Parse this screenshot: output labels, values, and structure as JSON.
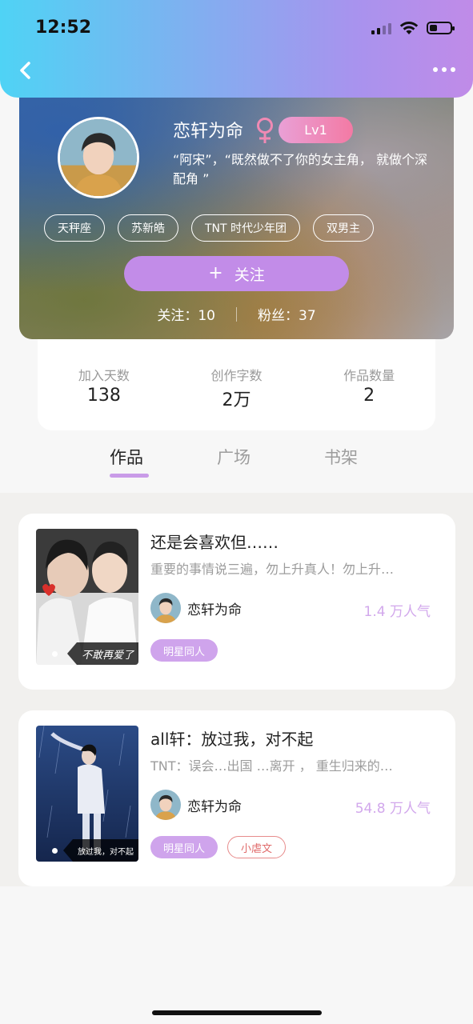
{
  "status_bar": {
    "time": "12:52"
  },
  "profile": {
    "nickname": "恋轩为命",
    "gender_symbol": "♀",
    "level": "Lv1",
    "bio": "“阿宋”，“既然做不了你的女主角， 就做个深",
    "bio_line2": "配角 ”",
    "tags": [
      "天秤座",
      "苏新皓",
      "TNT 时代少年团",
      "双男主"
    ],
    "follow_button": {
      "plus": "+",
      "label": "关注"
    },
    "following": {
      "label": "关注：",
      "value": "10"
    },
    "fans": {
      "label": "粉丝：",
      "value": "37"
    }
  },
  "stats": [
    {
      "label": "加入天数",
      "value": "138"
    },
    {
      "label": "创作字数",
      "value": "2万"
    },
    {
      "label": "作品数量",
      "value": "2"
    }
  ],
  "tabs": [
    {
      "label": "作品",
      "active": true
    },
    {
      "label": "广场",
      "active": false
    },
    {
      "label": "书架",
      "active": false
    }
  ],
  "works": [
    {
      "title": "还是会喜欢但……",
      "description": "重要的事情说三遍，勿上升真人！勿上升…",
      "author": "恋轩为命",
      "popularity": "1.4 万人气",
      "cover_caption": "不敢再爱了",
      "genres": [
        {
          "label": "明星同人",
          "style": "fill"
        }
      ]
    },
    {
      "title": "all轩：放过我，对不起",
      "description": "TNT：误会…出国 …离开 ， 重生归来的…",
      "author": "恋轩为命",
      "popularity": "54.8 万人气",
      "cover_caption": "放过我，对不起",
      "genres": [
        {
          "label": "明星同人",
          "style": "fill"
        },
        {
          "label": "小虐文",
          "style": "outline"
        }
      ]
    }
  ],
  "colors": {
    "accent_purple": "#c28ce8",
    "popularity": "#d2a8ec",
    "level_badge": "#f37aa4"
  }
}
